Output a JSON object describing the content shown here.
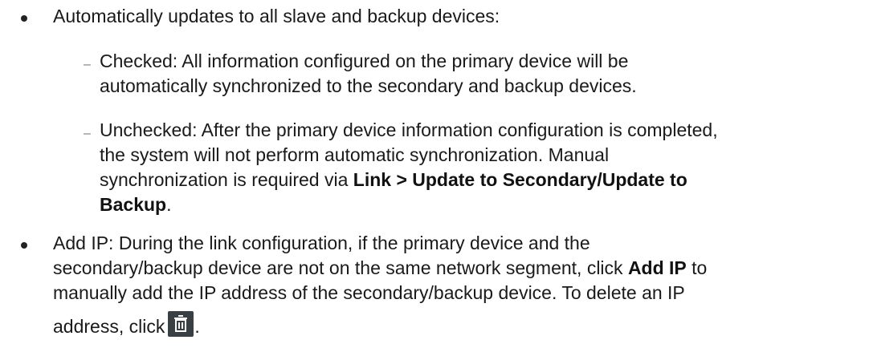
{
  "items": [
    {
      "text": "Automatically updates to all slave and backup devices:",
      "subitems": [
        {
          "line1": "Checked: All information configured on the primary device will be",
          "line2": "automatically synchronized to the secondary and backup devices."
        },
        {
          "line1": "Unchecked: After the primary device information configuration is completed,",
          "line2": "the system will not perform automatic synchronization. Manual",
          "line3_prefix": "synchronization is required via ",
          "line3_bold": "Link > Update to Secondary/Update to",
          "line4_bold": "Backup",
          "line4_suffix": "."
        }
      ]
    },
    {
      "line1": "Add IP: During the link configuration, if the primary device and the",
      "line2_prefix": "secondary/backup device are not on the same network segment, click ",
      "line2_bold": "Add IP",
      "line2_suffix": " to",
      "line3": "manually add the IP address of the secondary/backup device. To delete an IP",
      "line4_prefix": "address, click",
      "line4_suffix": ".",
      "icon": "trash-icon"
    }
  ],
  "colors": {
    "text": "#1a1a1a",
    "icon_bg": "#3a3f44",
    "dash": "#777777"
  }
}
